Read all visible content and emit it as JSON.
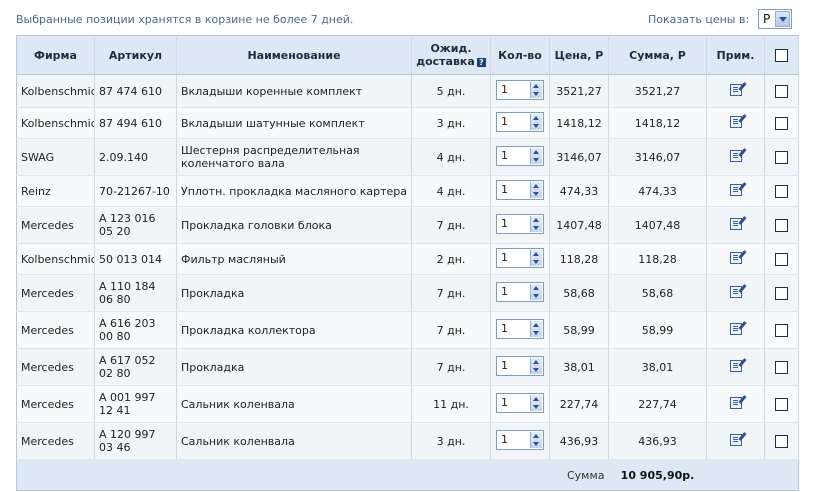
{
  "header": {
    "notice": "Выбранные позиции хранятся в корзине не более 7 дней.",
    "price_label": "Показать цены в:",
    "currency": "Р"
  },
  "columns": {
    "brand": "Фирма",
    "article": "Артикул",
    "name": "Наименование",
    "delivery_line1": "Ожид.",
    "delivery_line2": "доставка",
    "qty": "Кол-во",
    "price": "Цена, Р",
    "sum": "Сумма, Р",
    "note": "Прим."
  },
  "rows": [
    {
      "brand": "Kolbenschmidt",
      "article": "87 474 610",
      "name": "Вкладыши коренные комплект",
      "delivery": "5 дн.",
      "qty": "1",
      "price": "3521,27",
      "sum": "3521,27"
    },
    {
      "brand": "Kolbenschmidt",
      "article": "87 494 610",
      "name": "Вкладыши шатунные комплект",
      "delivery": "3 дн.",
      "qty": "1",
      "price": "1418,12",
      "sum": "1418,12"
    },
    {
      "brand": "SWAG",
      "article": "2.09.140",
      "name": "Шестерня распределительная коленчатого вала",
      "delivery": "4 дн.",
      "qty": "1",
      "price": "3146,07",
      "sum": "3146,07"
    },
    {
      "brand": "Reinz",
      "article": "70-21267-10",
      "name": "Уплотн. прокладка масляного картера",
      "delivery": "4 дн.",
      "qty": "1",
      "price": "474,33",
      "sum": "474,33"
    },
    {
      "brand": "Mercedes",
      "article": "A 123 016 05 20",
      "name": "Прокладка головки блока",
      "delivery": "7 дн.",
      "qty": "1",
      "price": "1407,48",
      "sum": "1407,48"
    },
    {
      "brand": "Kolbenschmidt",
      "article": "50 013 014",
      "name": "Фильтр масляный",
      "delivery": "2 дн.",
      "qty": "1",
      "price": "118,28",
      "sum": "118,28"
    },
    {
      "brand": "Mercedes",
      "article": "A 110 184 06 80",
      "name": "Прокладка",
      "delivery": "7 дн.",
      "qty": "1",
      "price": "58,68",
      "sum": "58,68"
    },
    {
      "brand": "Mercedes",
      "article": "A 616 203 00 80",
      "name": "Прокладка коллектора",
      "delivery": "7 дн.",
      "qty": "1",
      "price": "58,99",
      "sum": "58,99"
    },
    {
      "brand": "Mercedes",
      "article": "A 617 052 02 80",
      "name": "Прокладка",
      "delivery": "7 дн.",
      "qty": "1",
      "price": "38,01",
      "sum": "38,01"
    },
    {
      "brand": "Mercedes",
      "article": "A 001 997 12 41",
      "name": "Сальник коленвала",
      "delivery": "11 дн.",
      "qty": "1",
      "price": "227,74",
      "sum": "227,74"
    },
    {
      "brand": "Mercedes",
      "article": "A 120 997 03 46",
      "name": "Сальник коленвала",
      "delivery": "3 дн.",
      "qty": "1",
      "price": "436,93",
      "sum": "436,93"
    }
  ],
  "footer": {
    "total_label": "Сумма",
    "total_value": "10 905,90р."
  },
  "icons": {
    "info": "info-icon",
    "note": "edit-note-icon",
    "checkbox": "checkbox"
  },
  "colors": {
    "header_bg": "#dde8f4",
    "row_bg": "#f2f5f8",
    "border": "#b9c7d5",
    "notice_text": "#4a6a8a",
    "accent": "#1d3f7a"
  }
}
